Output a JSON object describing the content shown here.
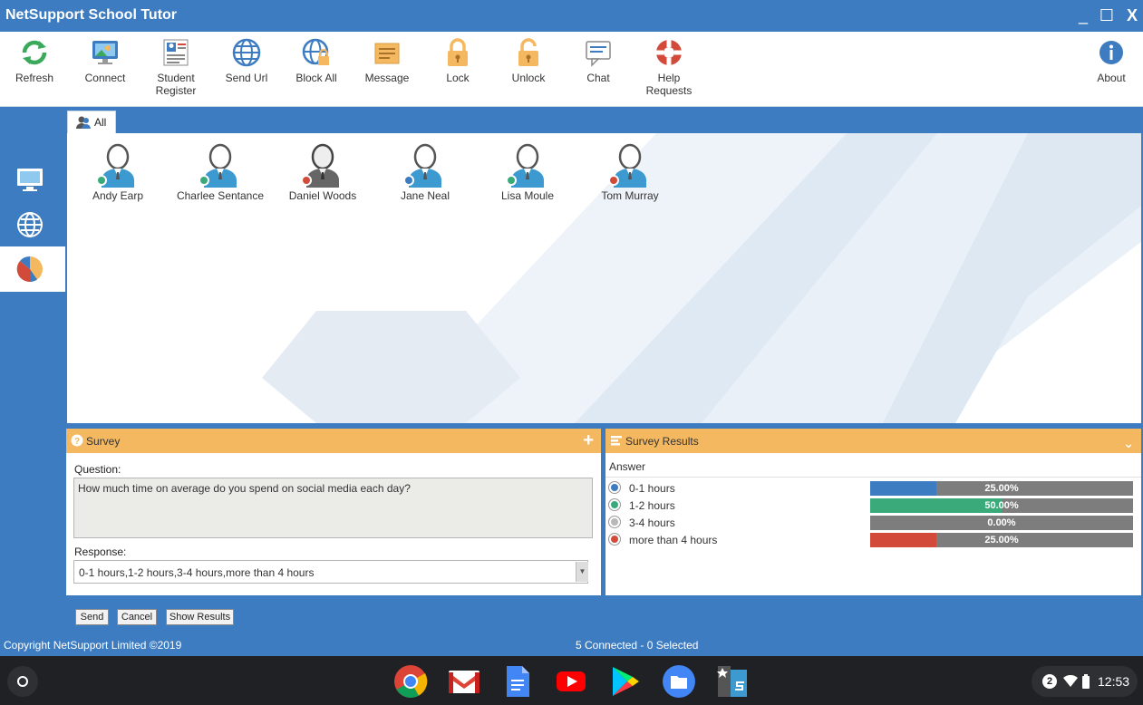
{
  "window": {
    "title": "NetSupport School Tutor",
    "min": "_",
    "max": "☐",
    "close": "X"
  },
  "toolbar": {
    "refresh": "Refresh",
    "connect": "Connect",
    "student_register": "Student Register",
    "send_url": "Send Url",
    "block_all": "Block All",
    "message": "Message",
    "lock": "Lock",
    "unlock": "Unlock",
    "chat": "Chat",
    "help_requests": "Help Requests",
    "about": "About"
  },
  "group_tab": {
    "label": "All"
  },
  "students": [
    {
      "name": "Andy Earp",
      "status_color": "#3aaa7a",
      "avatar": "light"
    },
    {
      "name": "Charlee Sentance",
      "status_color": "#3aaa7a",
      "avatar": "light"
    },
    {
      "name": "Daniel Woods",
      "status_color": "#d24a3a",
      "avatar": "dark"
    },
    {
      "name": "Jane Neal",
      "status_color": "#3d7cc0",
      "avatar": "light"
    },
    {
      "name": "Lisa Moule",
      "status_color": "#3aaa7a",
      "avatar": "light"
    },
    {
      "name": "Tom Murray",
      "status_color": "#d24a3a",
      "avatar": "light"
    }
  ],
  "survey": {
    "header": "Survey",
    "question_label": "Question:",
    "question": "How much time on average do you spend on social media each day?",
    "response_label": "Response:",
    "response": "0-1 hours,1-2 hours,3-4 hours,more than 4 hours",
    "add_icon": "+"
  },
  "results": {
    "header": "Survey Results",
    "answer_header": "Answer",
    "answers": [
      {
        "label": "0-1 hours",
        "percent_text": "25.00%",
        "fraction": 0.25,
        "color": "#3d7cc0"
      },
      {
        "label": "1-2 hours",
        "percent_text": "50.00%",
        "fraction": 0.5,
        "color": "#3aaa7a"
      },
      {
        "label": "3-4 hours",
        "percent_text": "0.00%",
        "fraction": 0.0,
        "color": "#b8b8b8"
      },
      {
        "label": "more than 4 hours",
        "percent_text": "25.00%",
        "fraction": 0.25,
        "color": "#d24a3a"
      }
    ]
  },
  "buttons": {
    "send": "Send",
    "cancel": "Cancel",
    "show_results": "Show Results"
  },
  "status": {
    "copyright": "Copyright NetSupport Limited ©2019",
    "connection": "5 Connected - 0 Selected"
  },
  "shelf": {
    "notifications": "2",
    "time": "12:53"
  },
  "colors": {
    "brand": "#3d7cc0",
    "panel_header": "#f4b860"
  }
}
